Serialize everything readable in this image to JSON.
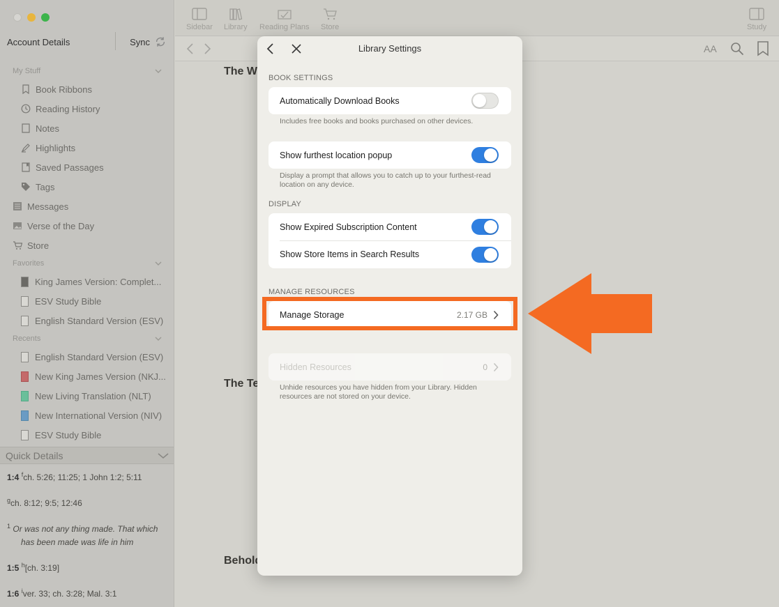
{
  "window": {
    "sidebar": {
      "account_label": "Account Details",
      "sync_label": "Sync",
      "sections": [
        {
          "title": "My Stuff",
          "items": [
            {
              "label": "Book Ribbons",
              "icon": "ribbon-icon"
            },
            {
              "label": "Reading History",
              "icon": "clock-icon"
            },
            {
              "label": "Notes",
              "icon": "note-icon"
            },
            {
              "label": "Highlights",
              "icon": "highlighter-icon"
            },
            {
              "label": "Saved Passages",
              "icon": "bookmark-doc-icon"
            },
            {
              "label": "Tags",
              "icon": "tag-icon"
            }
          ]
        }
      ],
      "top_items": [
        {
          "label": "Messages",
          "icon": "messages-icon"
        },
        {
          "label": "Verse of the Day",
          "icon": "image-icon"
        },
        {
          "label": "Store",
          "icon": "cart-icon"
        }
      ],
      "favorites": {
        "title": "Favorites",
        "items": [
          {
            "label": "King James Version: Complet..."
          },
          {
            "label": "ESV Study Bible"
          },
          {
            "label": "English Standard Version (ESV)"
          }
        ]
      },
      "recents": {
        "title": "Recents",
        "items": [
          {
            "label": "English Standard Version (ESV)"
          },
          {
            "label": "New King James Version (NKJ..."
          },
          {
            "label": "New Living Translation (NLT)"
          },
          {
            "label": "New International Version (NIV)"
          },
          {
            "label": "ESV Study Bible"
          }
        ]
      },
      "quick_details": {
        "title": "Quick Details",
        "entries": [
          {
            "ref": "1:4",
            "mark": "f",
            "text": "ch. 5:26; 11:25; 1 John 1:2; 5:11"
          },
          {
            "ref": "",
            "mark": "g",
            "text": "ch. 8:12; 9:5; 12:46"
          },
          {
            "ref": "",
            "mark": "1",
            "text_line1": "Or was not any thing made. That which",
            "text_line2": "has been made was life in him"
          },
          {
            "ref": "1:5",
            "mark": "h",
            "text": "[ch. 3:19]"
          },
          {
            "ref": "1:6",
            "mark": "i",
            "text": "ver. 33; ch. 3:28; Mal. 3:1"
          }
        ]
      }
    },
    "toolbar": {
      "sidebar_label": "Sidebar",
      "library_label": "Library",
      "reading_plans_label": "Reading Plans",
      "store_label": "Store",
      "study_label": "Study",
      "font_size_label": "AA"
    },
    "reader": {
      "heading1": "The Wo",
      "heading2": "The Te",
      "heading3": "Behold"
    }
  },
  "modal": {
    "title": "Library Settings",
    "book_settings": {
      "section_title": "BOOK SETTINGS",
      "auto_download_label": "Automatically Download Books",
      "auto_download_on": false,
      "auto_download_note": "Includes free books and books purchased on other devices.",
      "furthest_label": "Show furthest location popup",
      "furthest_on": true,
      "furthest_note": "Display a prompt that allows you to catch up to your furthest-read location on any device."
    },
    "display": {
      "section_title": "DISPLAY",
      "expired_label": "Show Expired Subscription Content",
      "expired_on": true,
      "store_items_label": "Show Store Items in Search Results",
      "store_items_on": true
    },
    "manage_resources": {
      "section_title": "MANAGE RESOURCES",
      "storage_label": "Manage Storage",
      "storage_value": "2.17 GB",
      "hidden_label": "Hidden Resources",
      "hidden_value": "0",
      "hidden_note": "Unhide resources you have hidden from your Library. Hidden resources are not stored on your device."
    }
  },
  "annotation": {
    "highlight_color": "#f46a22",
    "arrow_color": "#f46a22"
  }
}
